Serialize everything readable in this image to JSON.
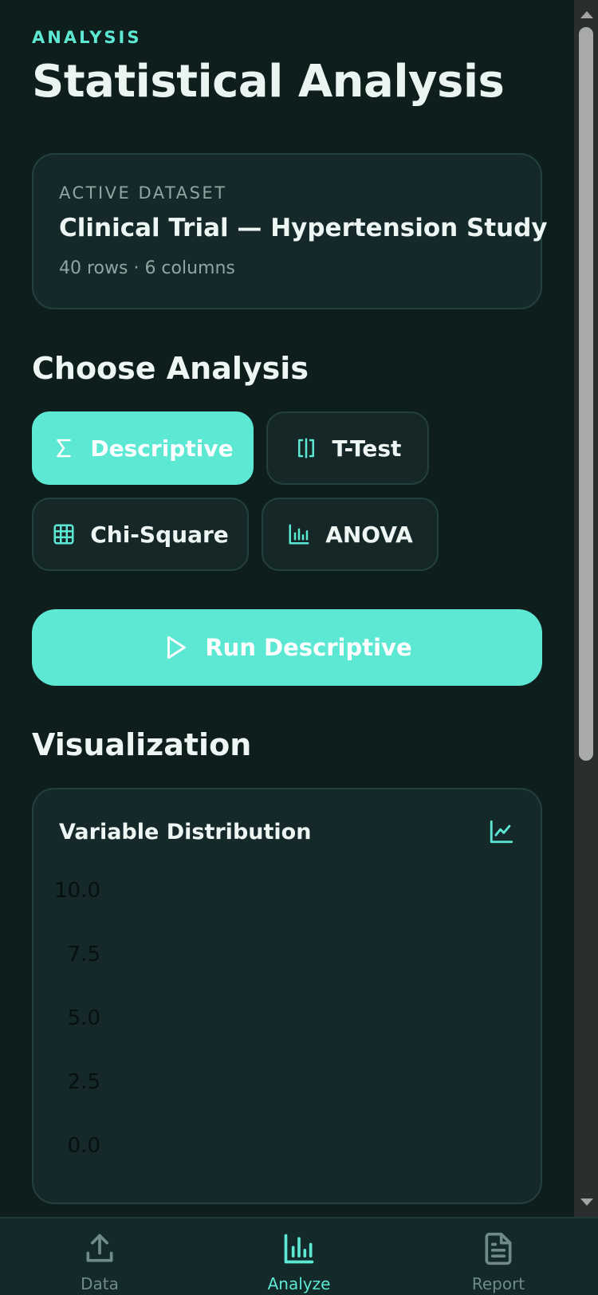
{
  "header": {
    "eyebrow": "ANALYSIS",
    "title": "Statistical Analysis"
  },
  "dataset": {
    "label": "ACTIVE DATASET",
    "name": "Clinical Trial — Hypertension Study",
    "meta": "40 rows · 6 columns"
  },
  "analysis": {
    "section_title": "Choose Analysis",
    "options": [
      {
        "label": "Descriptive",
        "icon": "sigma-icon",
        "selected": true
      },
      {
        "label": "T-Test",
        "icon": "split-bracket-icon",
        "selected": false
      },
      {
        "label": "Chi-Square",
        "icon": "grid-icon",
        "selected": false
      },
      {
        "label": "ANOVA",
        "icon": "bar-chart-icon",
        "selected": false
      }
    ],
    "run_label": "Run Descriptive"
  },
  "visualization": {
    "section_title": "Visualization",
    "card_title": "Variable Distribution",
    "icon": "line-chart-icon"
  },
  "chart_data": {
    "type": "bar",
    "title": "",
    "xlabel": "",
    "ylabel": "",
    "y_ticks": [
      "10.0",
      "7.5",
      "5.0",
      "2.5",
      "0.0"
    ],
    "ylim": [
      0,
      10
    ],
    "series": []
  },
  "tabbar": {
    "tabs": [
      {
        "label": "Data",
        "icon": "upload-icon",
        "active": false
      },
      {
        "label": "Analyze",
        "icon": "bar-chart-icon",
        "active": true
      },
      {
        "label": "Report",
        "icon": "document-icon",
        "active": false
      }
    ]
  },
  "colors": {
    "accent": "#5de8d4",
    "background": "#0d1e1d",
    "card": "#16292a"
  }
}
